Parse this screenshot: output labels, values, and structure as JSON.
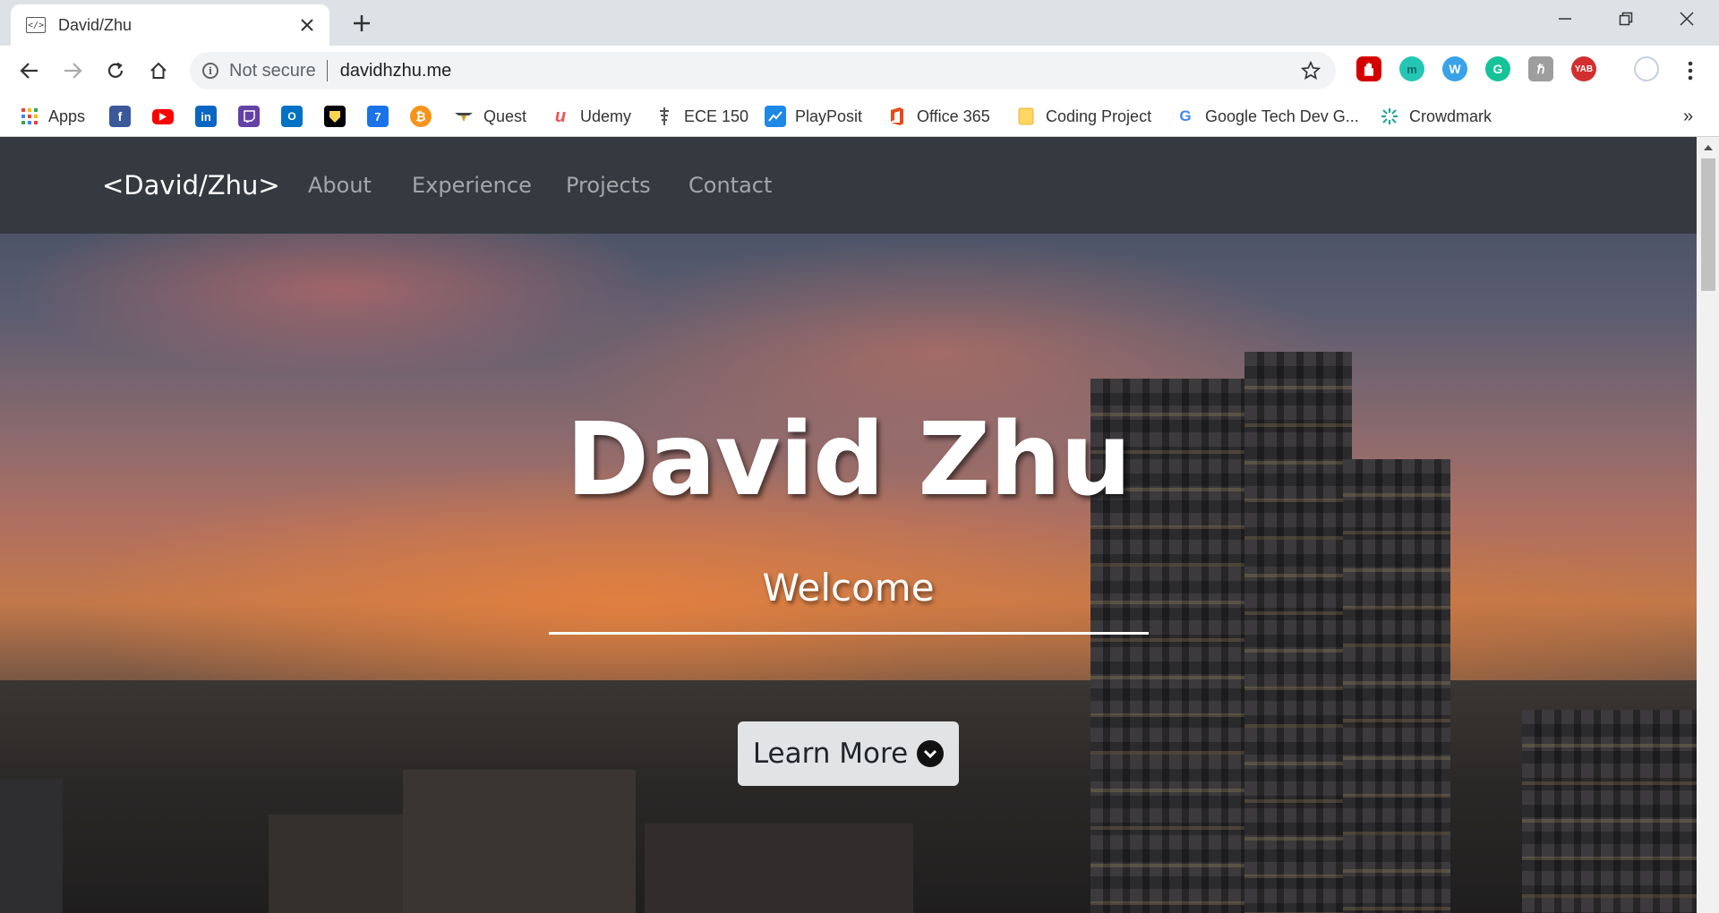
{
  "browser": {
    "tab": {
      "title": "David/Zhu",
      "favicon": "</>"
    },
    "omnibox": {
      "security_label": "Not secure",
      "url": "davidhzhu.me"
    },
    "bookmarks": [
      {
        "label": "Apps",
        "icon": "apps-grid-icon"
      },
      {
        "label": "",
        "icon": "facebook-icon"
      },
      {
        "label": "",
        "icon": "youtube-icon"
      },
      {
        "label": "",
        "icon": "linkedin-icon"
      },
      {
        "label": "",
        "icon": "twitch-icon"
      },
      {
        "label": "",
        "icon": "outlook-icon"
      },
      {
        "label": "",
        "icon": "waterloo-icon"
      },
      {
        "label": "",
        "icon": "calendar-icon"
      },
      {
        "label": "",
        "icon": "bitcoin-icon"
      },
      {
        "label": "Quest",
        "icon": "quest-icon"
      },
      {
        "label": "Udemy",
        "icon": "udemy-icon"
      },
      {
        "label": "ECE 150",
        "icon": "ece-icon"
      },
      {
        "label": "PlayPosit",
        "icon": "playposit-icon"
      },
      {
        "label": "Office 365",
        "icon": "office-icon"
      },
      {
        "label": "Coding Project",
        "icon": "folder-icon"
      },
      {
        "label": "Google Tech Dev G...",
        "icon": "google-icon"
      },
      {
        "label": "Crowdmark",
        "icon": "crowdmark-icon"
      }
    ],
    "overflow": "»",
    "extensions": [
      "adblock-icon",
      "m-extension-icon",
      "w-extension-icon",
      "grammarly-icon",
      "h-extension-icon",
      "yab-extension-icon",
      "profile-icon"
    ],
    "yab_label": "YAB",
    "calendar_day": "7"
  },
  "site": {
    "brand": "<David/Zhu>",
    "nav": [
      "About",
      "Experience",
      "Projects",
      "Contact"
    ],
    "hero": {
      "title": "David Zhu",
      "subtitle": "Welcome",
      "button_label": "Learn More"
    }
  },
  "colors": {
    "navbar_bg": "#343a40",
    "button_bg": "#e2e3e5"
  }
}
